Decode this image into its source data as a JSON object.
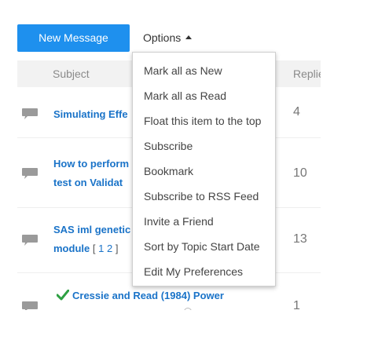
{
  "toolbar": {
    "new_message_label": "New Message",
    "options_label": "Options"
  },
  "table": {
    "headers": {
      "subject": "Subject",
      "replies": "Replie"
    },
    "rows": [
      {
        "subject_line1": "Simulating Effe",
        "subject_line2": "",
        "replies": "4"
      },
      {
        "subject_line1": "How to perform",
        "subject_line2": "test on Validat",
        "replies": "10"
      },
      {
        "subject_line1": "SAS iml genetic",
        "subject_line2": "module",
        "pages_open": "[",
        "page_1": "1",
        "page_2": "2",
        "pages_close": "]",
        "replies": "13"
      },
      {
        "subject_line1": "Cressie and Read (1984) Power",
        "subject_line2": "",
        "replies": "1",
        "solved": true
      }
    ]
  },
  "menu": {
    "items": [
      "Mark all as New",
      "Mark all as Read",
      "Float this item to the top",
      "Subscribe",
      "Bookmark",
      "Subscribe to RSS Feed",
      "Invite a Friend",
      "Sort by Topic Start Date",
      "Edit My Preferences"
    ]
  },
  "colors": {
    "accent": "#1e90ee",
    "link": "#1a73c8",
    "header_bg": "#f2f2f2",
    "solved_check": "#2ea043",
    "icon_gray": "#9a9a9a"
  }
}
